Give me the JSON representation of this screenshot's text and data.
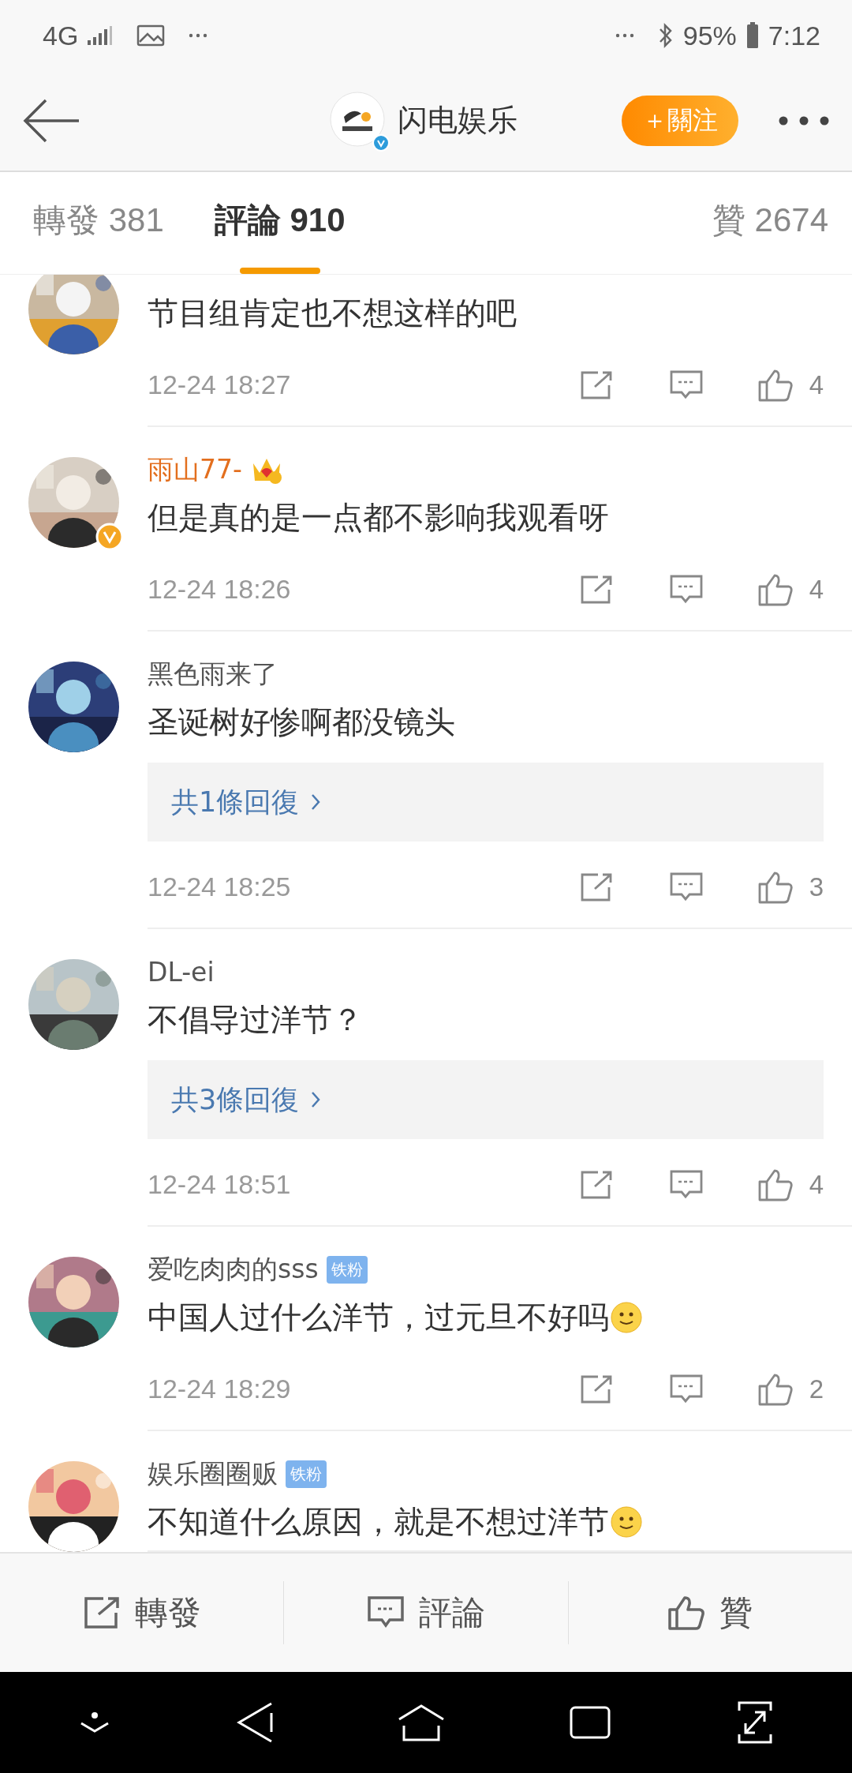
{
  "status_bar": {
    "network": "4G",
    "battery": "95%",
    "time": "7:12"
  },
  "header": {
    "title": "闪电娱乐",
    "follow_button": "＋關注"
  },
  "tabs": [
    {
      "label": "轉發 381",
      "selected": false
    },
    {
      "label": "評論 910",
      "selected": true
    },
    {
      "label": "贊 2674",
      "selected": false
    }
  ],
  "comments": [
    {
      "text": "节目组肯定也不想这样的吧",
      "time": "12-24 18:27",
      "likes": "4",
      "verified": false,
      "emoji": false
    },
    {
      "name": "雨山77-",
      "text": "但是真的是一点都不影响我观看呀",
      "time": "12-24 18:26",
      "likes": "4",
      "vip": true,
      "verified": true,
      "emoji": false
    },
    {
      "name": "黑色雨来了",
      "text": "圣诞树好惨啊都没镜头",
      "replies": "共1條回復",
      "time": "12-24 18:25",
      "likes": "3",
      "vip": false,
      "verified": false,
      "emoji": false
    },
    {
      "name": "DL-ei",
      "text": "不倡导过洋节？",
      "replies": "共3條回復",
      "time": "12-24 18:51",
      "likes": "4",
      "vip": false,
      "verified": false,
      "emoji": false
    },
    {
      "name": "爱吃肉肉的sss",
      "badge": "铁粉",
      "text": "中国人过什么洋节，过元旦不好吗",
      "time": "12-24 18:29",
      "likes": "2",
      "vip": false,
      "verified": false,
      "emoji": true
    },
    {
      "name": "娱乐圈圈贩",
      "badge": "铁粉",
      "text": "不知道什么原因，就是不想过洋节",
      "vip": false,
      "verified": false,
      "emoji": true
    }
  ],
  "bottom_bar": [
    {
      "label": "轉發",
      "kind": "repost"
    },
    {
      "label": "評論",
      "kind": "comment"
    },
    {
      "label": "贊",
      "kind": "like"
    }
  ]
}
